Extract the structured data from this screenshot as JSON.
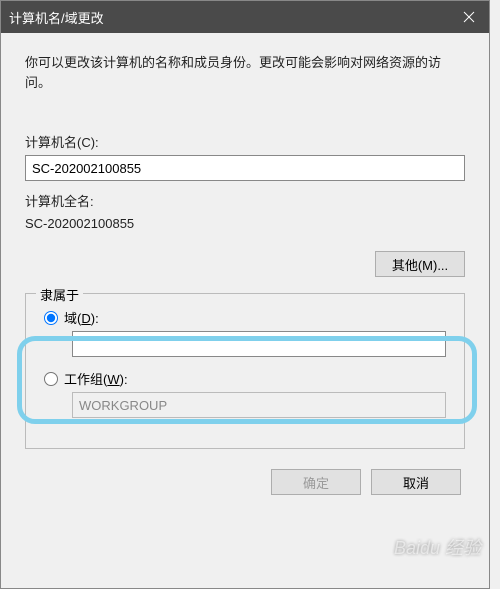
{
  "titlebar": {
    "title": "计算机名/域更改"
  },
  "description": "你可以更改该计算机的名称和成员身份。更改可能会影响对网络资源的访问。",
  "computer_name": {
    "label": "计算机名(C):",
    "value": "SC-202002100855"
  },
  "full_name": {
    "label": "计算机全名:",
    "value": "SC-202002100855"
  },
  "other_button": "其他(M)...",
  "member_of": {
    "legend": "隶属于",
    "domain": {
      "label_prefix": "域(",
      "label_key": "D",
      "label_suffix": "):",
      "value": ""
    },
    "workgroup": {
      "label_prefix": "工作组(",
      "label_key": "W",
      "label_suffix": "):",
      "value": "WORKGROUP"
    }
  },
  "buttons": {
    "ok": "确定",
    "cancel": "取消"
  },
  "watermark": "Baidu 经验"
}
